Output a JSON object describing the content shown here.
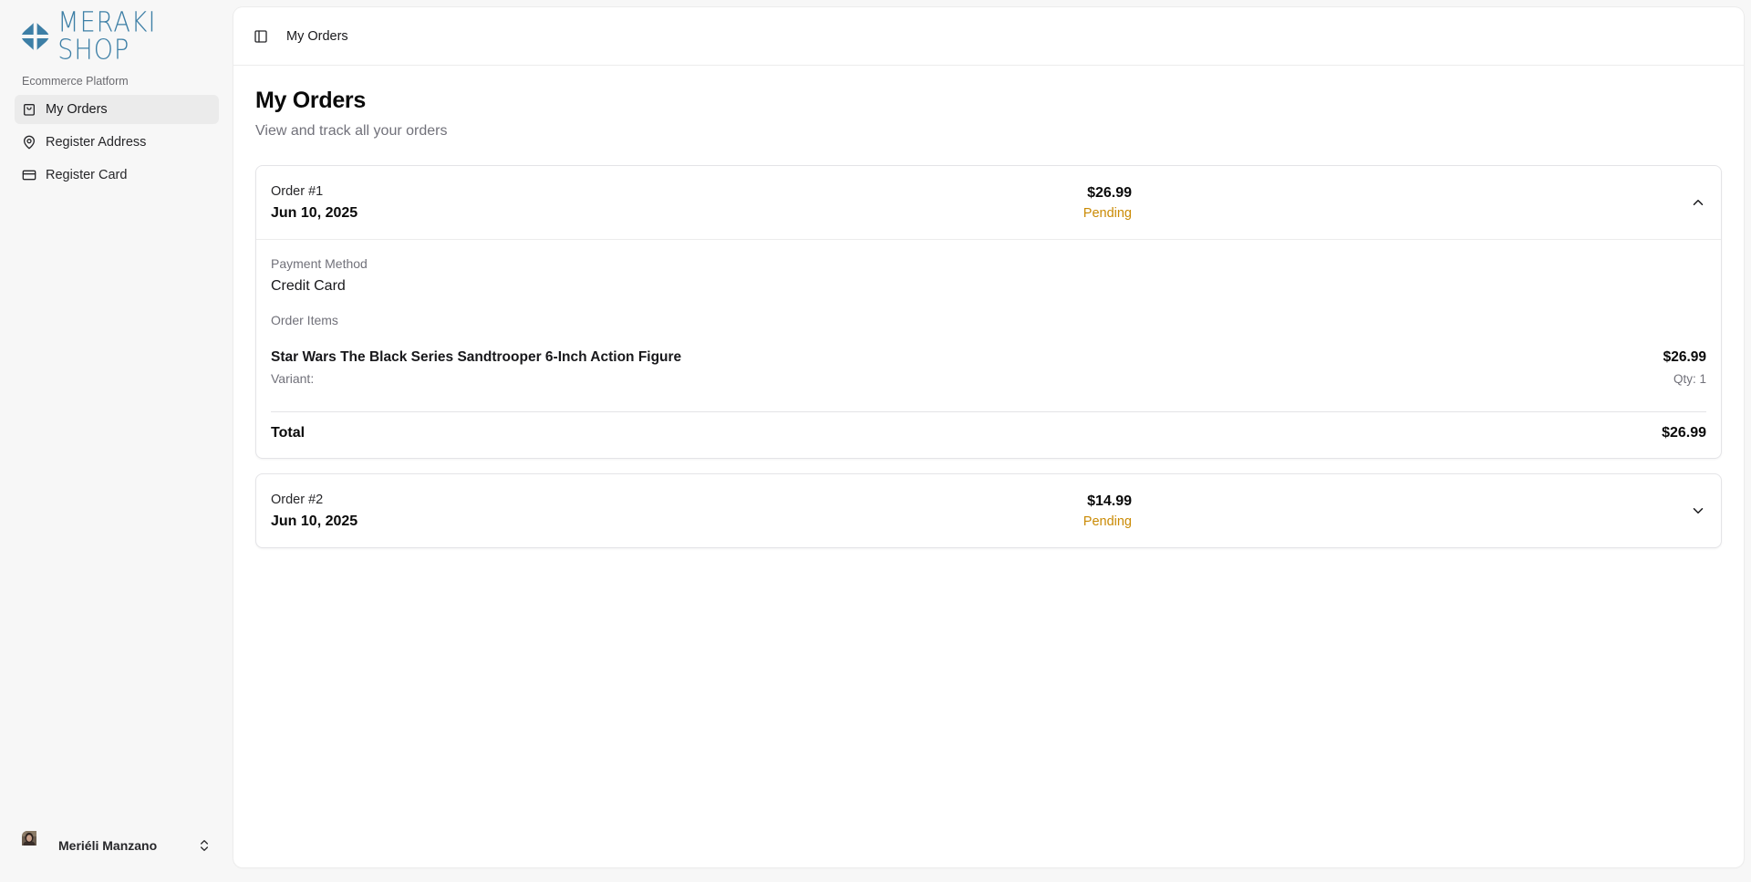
{
  "brand": {
    "name": "MERAKI SHOP",
    "color": "#3d7fa6",
    "logo_icon": "meraki-logo-icon"
  },
  "sidebar": {
    "group_label": "Ecommerce Platform",
    "items": [
      {
        "label": "My Orders",
        "icon": "shopping-bag-icon",
        "active": true
      },
      {
        "label": "Register Address",
        "icon": "map-pin-icon",
        "active": false
      },
      {
        "label": "Register Card",
        "icon": "credit-card-icon",
        "active": false
      }
    ],
    "user": {
      "name": "Meriéli Manzano",
      "menu_icon": "chevrons-up-down-icon"
    }
  },
  "header": {
    "toggle_icon": "sidebar-toggle-icon",
    "breadcrumb": "My Orders"
  },
  "page": {
    "title": "My Orders",
    "subtitle": "View and track all your orders"
  },
  "orders": [
    {
      "number": "Order #1",
      "date": "Jun 10, 2025",
      "amount": "$26.99",
      "status": "Pending",
      "status_color": "#ca8a04",
      "expanded": true,
      "payment_label": "Payment Method",
      "payment_value": "Credit Card",
      "items_label": "Order Items",
      "items": [
        {
          "name": "Star Wars The Black Series Sandtrooper 6-Inch Action Figure",
          "variant": "Variant:",
          "price": "$26.99",
          "qty": "Qty: 1"
        }
      ],
      "total_label": "Total",
      "total_value": "$26.99"
    },
    {
      "number": "Order #2",
      "date": "Jun 10, 2025",
      "amount": "$14.99",
      "status": "Pending",
      "status_color": "#ca8a04",
      "expanded": false
    }
  ]
}
